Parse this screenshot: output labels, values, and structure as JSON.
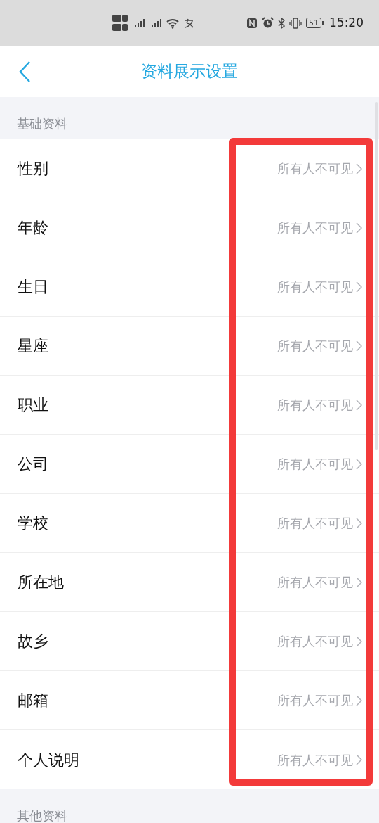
{
  "status_bar": {
    "time": "15:20",
    "battery": "51"
  },
  "header": {
    "title": "资料展示设置"
  },
  "sections": [
    {
      "title": "基础资料",
      "items": [
        {
          "label": "性别",
          "value": "所有人不可见"
        },
        {
          "label": "年龄",
          "value": "所有人不可见"
        },
        {
          "label": "生日",
          "value": "所有人不可见"
        },
        {
          "label": "星座",
          "value": "所有人不可见"
        },
        {
          "label": "职业",
          "value": "所有人不可见"
        },
        {
          "label": "公司",
          "value": "所有人不可见"
        },
        {
          "label": "学校",
          "value": "所有人不可见"
        },
        {
          "label": "所在地",
          "value": "所有人不可见"
        },
        {
          "label": "故乡",
          "value": "所有人不可见"
        },
        {
          "label": "邮箱",
          "value": "所有人不可见"
        },
        {
          "label": "个人说明",
          "value": "所有人不可见"
        }
      ]
    },
    {
      "title": "其他资料"
    }
  ],
  "highlight_frame": true
}
